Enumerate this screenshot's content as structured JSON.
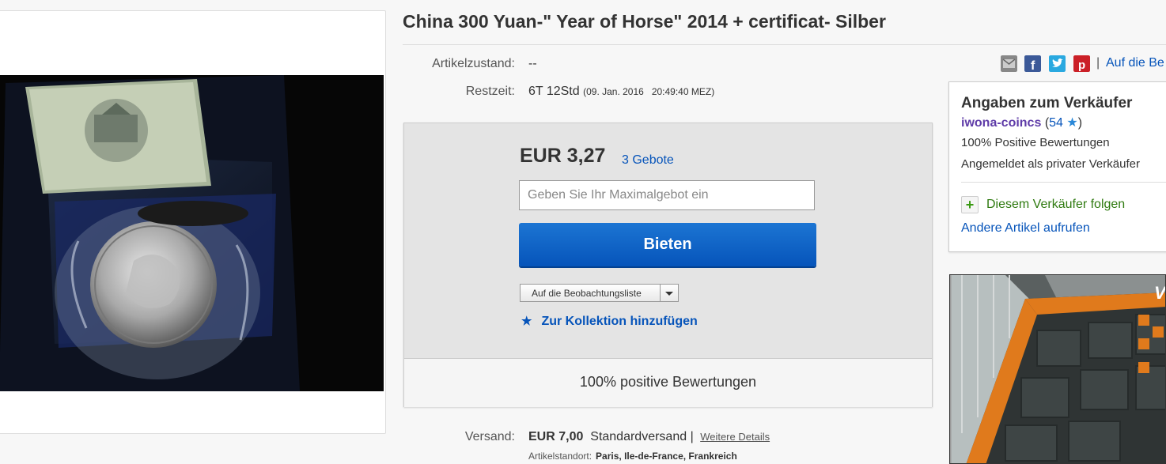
{
  "title": "China 300 Yuan-\" Year of Horse\" 2014 + certificat- Silber",
  "condition": {
    "label": "Artikelzustand:",
    "value": "--"
  },
  "time_left": {
    "label": "Restzeit:",
    "value": "6T 12Std",
    "end": "(09. Jan. 2016   20:49:40 MEZ)"
  },
  "share": {
    "icons": [
      "email-icon",
      "facebook-icon",
      "twitter-icon",
      "pinterest-icon"
    ],
    "watch_link": "Auf die Be"
  },
  "bid": {
    "price": "EUR 3,27",
    "bids_count": "3 Gebote",
    "input_placeholder": "Geben Sie Ihr Maximalgebot ein",
    "button": "Bieten",
    "watch_dropdown": "Auf die Beobachtungsliste",
    "collection": "Zur Kollektion hinzufügen",
    "positive": "100% positive Bewertungen"
  },
  "seller": {
    "title": "Angaben zum Verkäufer",
    "name": "iwona-coincs",
    "score_open": "(",
    "score": "54",
    "score_close": ")",
    "positive": "100% Positive Bewertungen",
    "registered": "Angemeldet als privater Verkäufer",
    "follow": "Diesem Verkäufer folgen",
    "other_items": "Andere Artikel aufrufen"
  },
  "shipping": {
    "label": "Versand:",
    "price": "EUR 7,00",
    "method": "Standardversand |",
    "details": "Weitere Details",
    "location_label": "Artikelstandort:",
    "location": "Paris, Ile-de-France, Frankreich"
  },
  "colors": {
    "link": "#0654ba",
    "button": "#0654ba",
    "follow": "#2f7a10",
    "seller_name": "#5f3ca8"
  }
}
